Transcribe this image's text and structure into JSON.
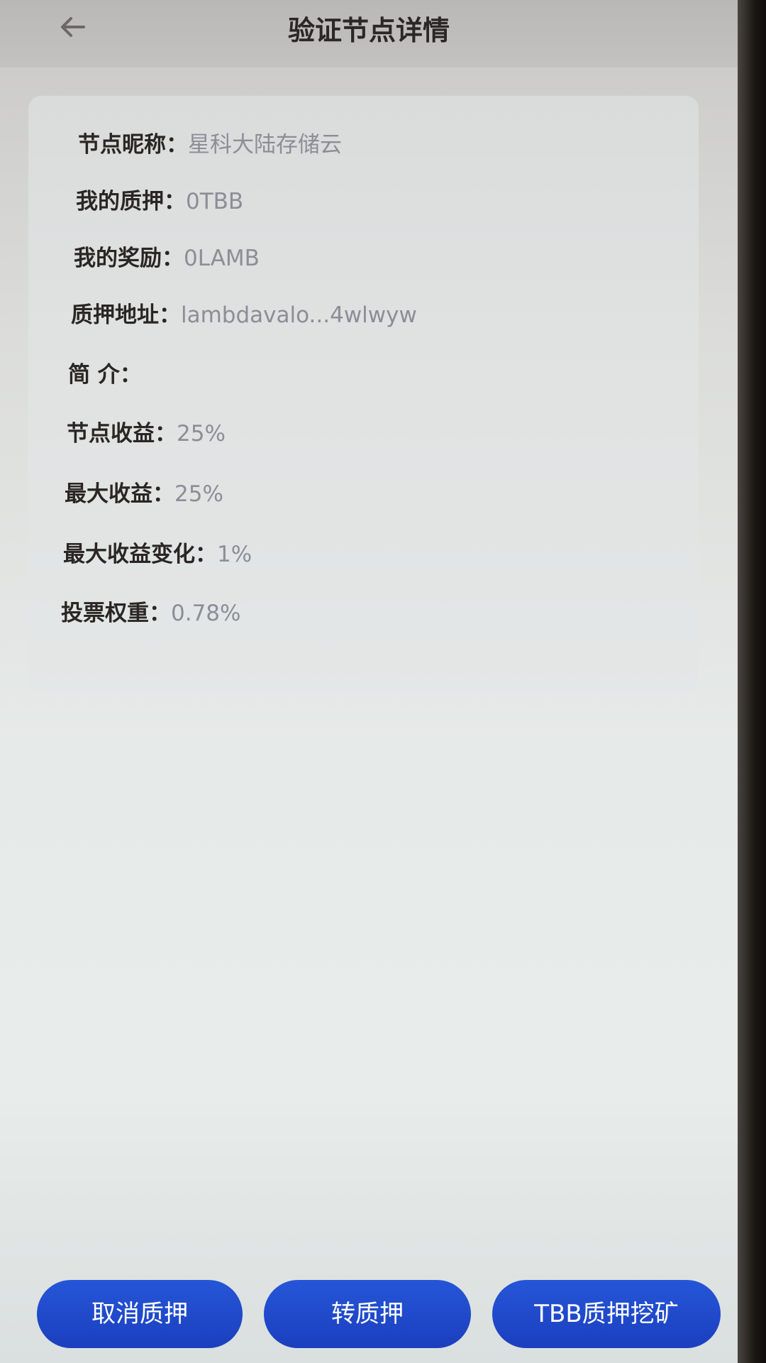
{
  "header": {
    "title": "验证节点详情",
    "back_icon": "arrow-left-icon"
  },
  "details": [
    {
      "label": "节点昵称：",
      "value": "星科大陆存储云"
    },
    {
      "label": "我的质押：",
      "value": "0TBB"
    },
    {
      "label": "我的奖励：",
      "value": "0LAMB"
    },
    {
      "label": "质押地址：",
      "value": "lambdavalo...4wlwyw"
    },
    {
      "label": "简 介：",
      "value": ""
    },
    {
      "label": "节点收益：",
      "value": "25%"
    },
    {
      "label": "最大收益：",
      "value": "25%"
    },
    {
      "label": "最大收益变化：",
      "value": "1%"
    },
    {
      "label": "投票权重：",
      "value": "0.78%"
    }
  ],
  "actions": {
    "cancel_stake": "取消质押",
    "transfer_stake": "转质押",
    "tbb_mining": "TBB质押挖矿"
  },
  "colors": {
    "button": "#1f4bcc",
    "label": "#2a2624",
    "value": "#8b8e97"
  }
}
